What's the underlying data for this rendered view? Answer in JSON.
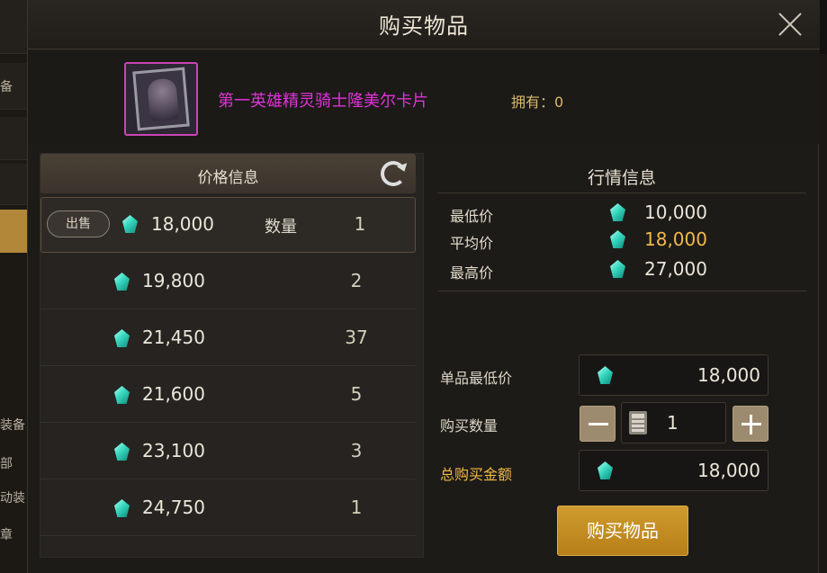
{
  "dialog": {
    "title": "购买物品",
    "item_name": "第一英雄精灵骑士隆美尔卡片",
    "owned_label": "拥有：0"
  },
  "background": {
    "left_labels": [
      "备",
      "装备",
      "部",
      "动装",
      "章"
    ]
  },
  "price_panel": {
    "header": "价格信息",
    "sell_label": "出售",
    "quantity_label": "数量",
    "currency_icon": "gem-icon",
    "rows": [
      {
        "price": "18,000",
        "qty": "1"
      },
      {
        "price": "19,800",
        "qty": "2"
      },
      {
        "price": "21,450",
        "qty": "37"
      },
      {
        "price": "21,600",
        "qty": "5"
      },
      {
        "price": "23,100",
        "qty": "3"
      },
      {
        "price": "24,750",
        "qty": "1"
      }
    ]
  },
  "market": {
    "title": "行情信息",
    "min_label": "最低价",
    "min_value": "10,000",
    "avg_label": "平均价",
    "avg_value": "18,000",
    "max_label": "最高价",
    "max_value": "27,000"
  },
  "purchase": {
    "unit_min_label": "单品最低价",
    "unit_min_value": "18,000",
    "qty_label": "购买数量",
    "qty_value": "1",
    "total_label": "总购买金额",
    "total_value": "18,000",
    "buy_button": "购买物品"
  },
  "colors": {
    "item_name": "#e033d8",
    "owned": "#d7b96a",
    "avg_price": "#f2b84b",
    "total_label": "#f0b844",
    "buy_button": "#c48c22"
  }
}
